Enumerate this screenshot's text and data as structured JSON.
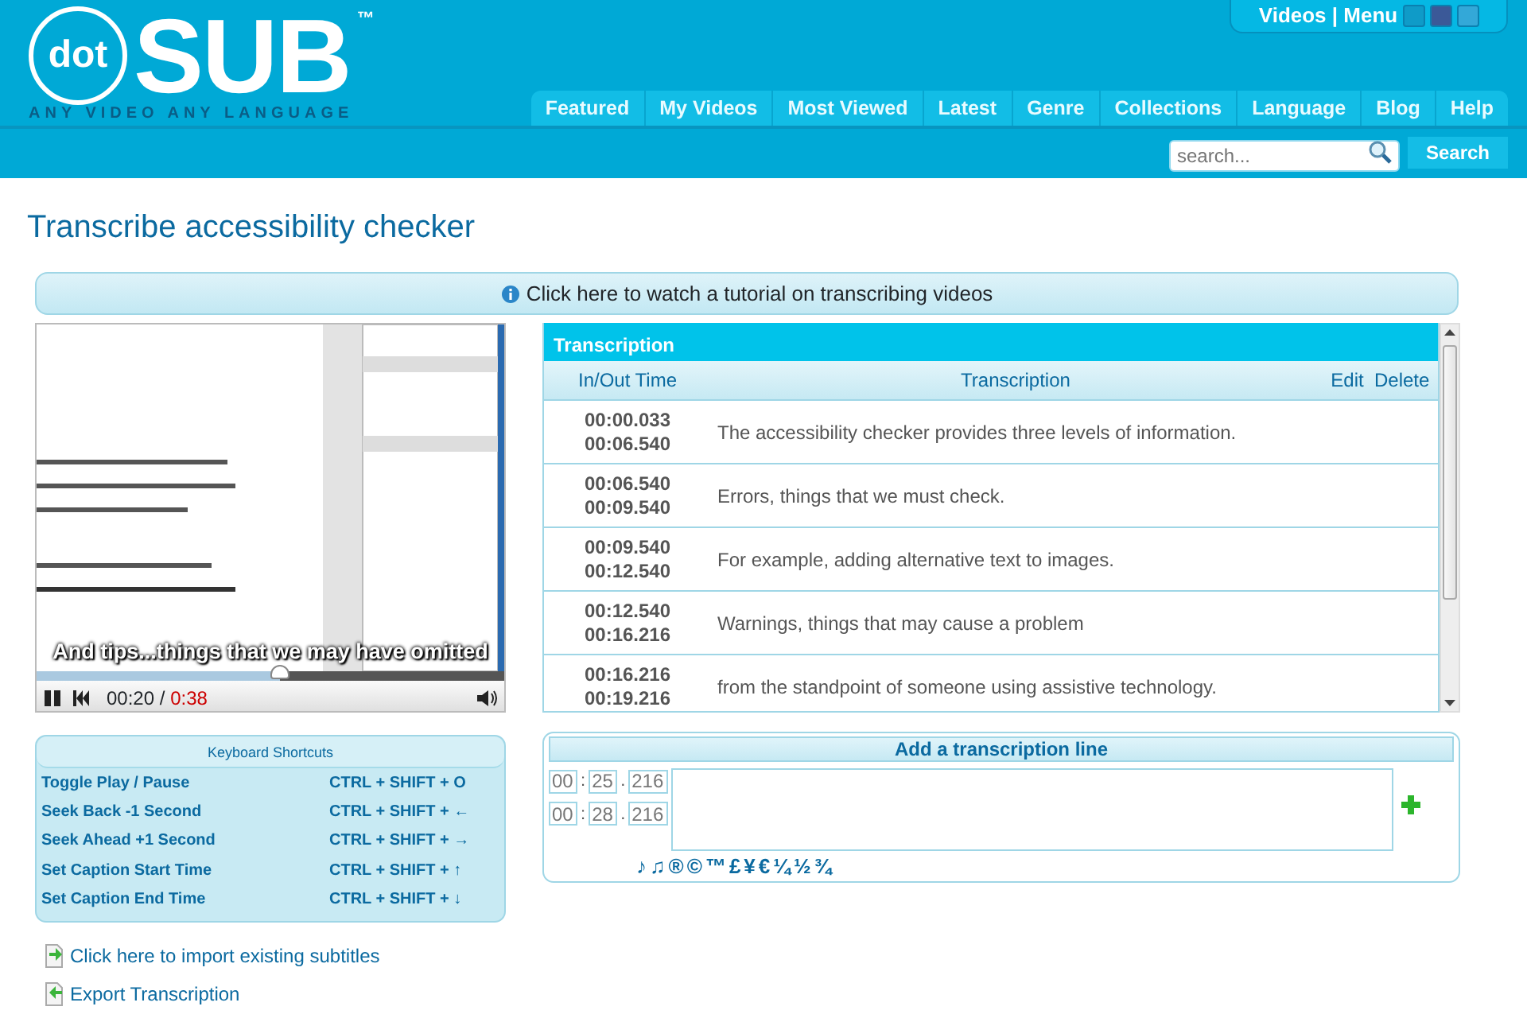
{
  "header": {
    "logo": {
      "circle": "dot",
      "word": "SUB",
      "mark": "™",
      "tagline": "ANY VIDEO ANY LANGUAGE"
    },
    "top_menu": {
      "label": "Videos | Menu"
    },
    "nav": [
      "Featured",
      "My Videos",
      "Most Viewed",
      "Latest",
      "Genre",
      "Collections",
      "Language",
      "Blog",
      "Help"
    ],
    "search": {
      "placeholder": "search...",
      "button": "Search"
    }
  },
  "page_title": "Transcribe accessibility checker",
  "tutorial_link": "Click here to watch a tutorial on transcribing videos",
  "player": {
    "caption": "And tips...things that we may have omitted",
    "elapsed": "00:20",
    "separator": "/",
    "duration": "0:38",
    "level": 0.52
  },
  "shortcuts": {
    "title": "Keyboard Shortcuts",
    "rows": [
      {
        "action": "Toggle Play / Pause",
        "keys": "CTRL + SHIFT + O"
      },
      {
        "action": "Seek Back -1 Second",
        "keys": "CTRL + SHIFT + ←"
      },
      {
        "action": "Seek Ahead +1 Second",
        "keys": "CTRL + SHIFT + →"
      },
      {
        "action": "Set Caption Start Time",
        "keys": "CTRL + SHIFT + ↑"
      },
      {
        "action": "Set Caption End Time",
        "keys": "CTRL + SHIFT + ↓"
      }
    ]
  },
  "links": [
    {
      "kind": "import",
      "label": "Click here to import existing subtitles"
    },
    {
      "kind": "export",
      "label": "Export Transcription"
    }
  ],
  "transcription": {
    "title": "Transcription",
    "columns": [
      "In/Out Time",
      "Transcription",
      "Edit",
      "Delete"
    ],
    "rows": [
      {
        "in": "00:00.033",
        "out": "00:06.540",
        "text": "The accessibility checker provides three levels of information."
      },
      {
        "in": "00:06.540",
        "out": "00:09.540",
        "text": "Errors, things that we must check."
      },
      {
        "in": "00:09.540",
        "out": "00:12.540",
        "text": "For example, adding alternative text to images."
      },
      {
        "in": "00:12.540",
        "out": "00:16.216",
        "text": "Warnings, things that may cause a problem"
      },
      {
        "in": "00:16.216",
        "out": "00:19.216",
        "text": "from the standpoint of someone using assistive technology."
      }
    ]
  },
  "add_line": {
    "title": "Add a transcription line",
    "start": {
      "min": "00",
      "sep1": ":",
      "sec": "25",
      "sep2": ".",
      "ms": "216"
    },
    "end": {
      "min": "00",
      "sep1": ":",
      "sec": "28",
      "sep2": ".",
      "ms": "216"
    },
    "symbols": [
      "♪",
      "♫",
      "®",
      "©",
      "™",
      "£",
      "¥",
      "€",
      "¼",
      "½",
      "¾"
    ]
  }
}
